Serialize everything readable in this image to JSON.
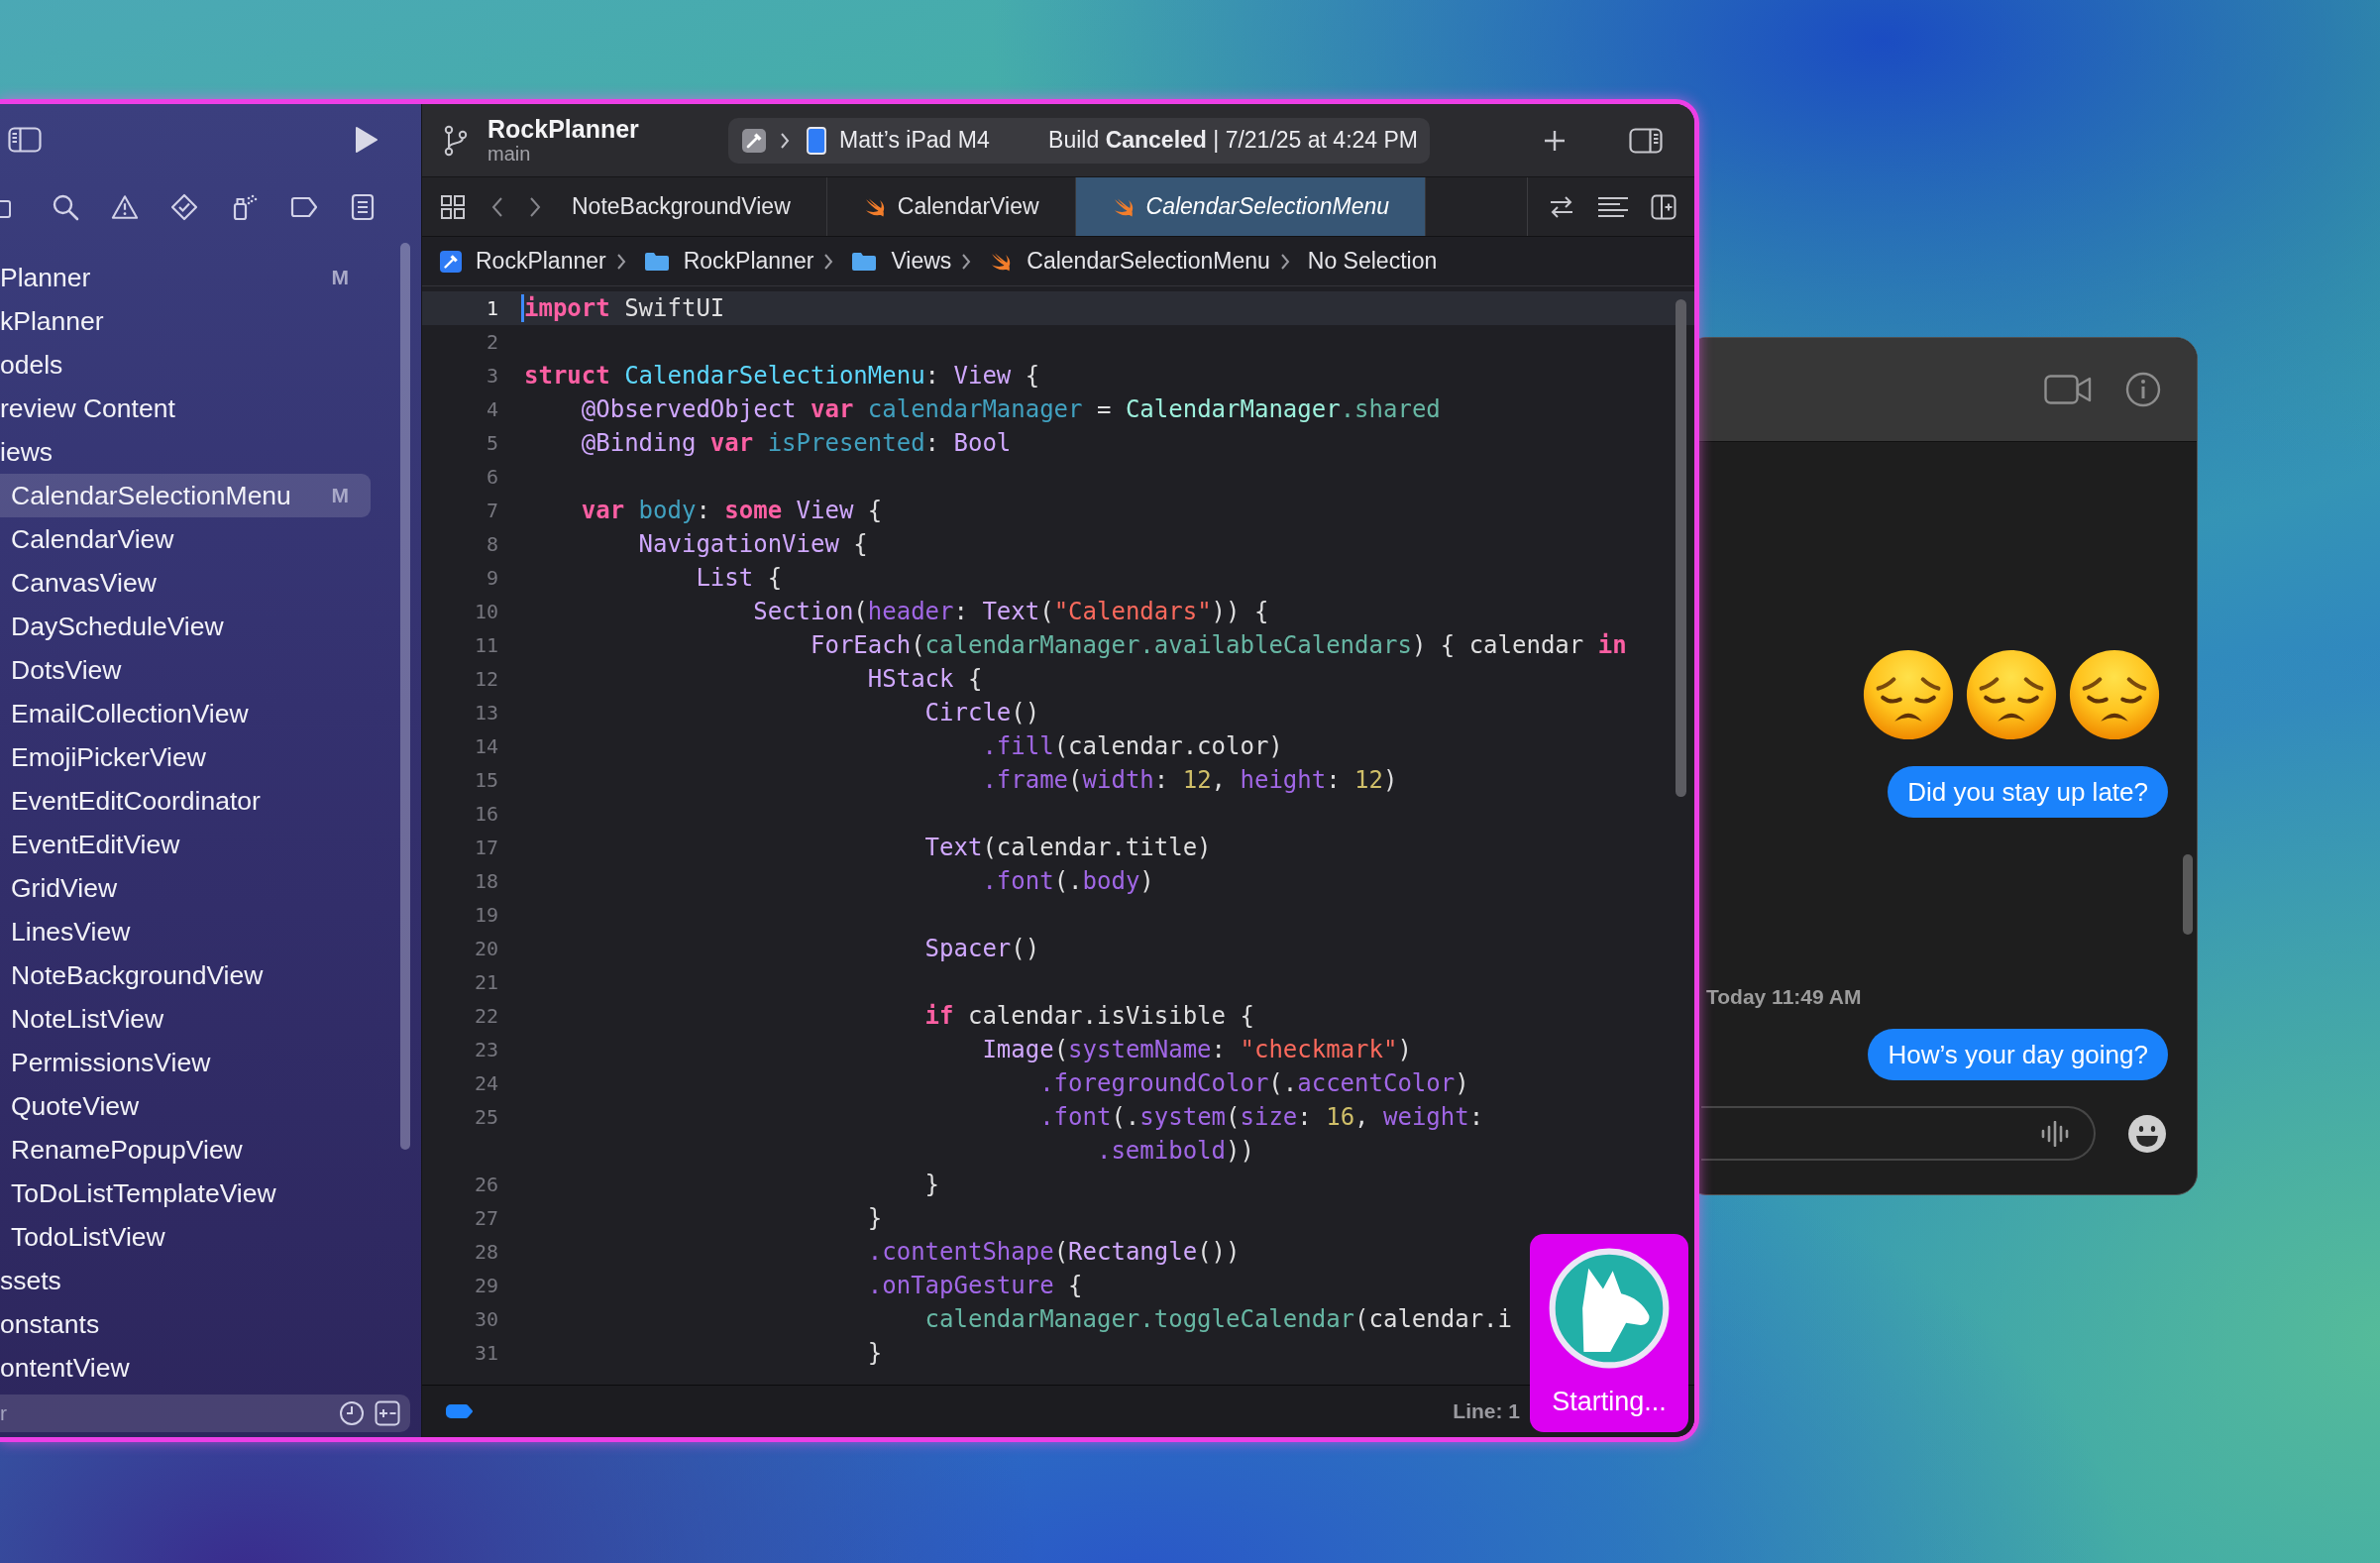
{
  "xcode": {
    "sidebar": {
      "files": [
        {
          "label": "Planner",
          "badge": "M",
          "selected": false
        },
        {
          "label": "kPlanner",
          "selected": false
        },
        {
          "label": "odels",
          "selected": false
        },
        {
          "label": "review Content",
          "selected": false
        },
        {
          "label": "iews",
          "selected": false,
          "children": [
            {
              "label": "CalendarSelectionMenu",
              "badge": "M",
              "selected": true
            },
            {
              "label": "CalendarView",
              "selected": false
            },
            {
              "label": "CanvasView",
              "selected": false
            },
            {
              "label": "DayScheduleView",
              "selected": false
            },
            {
              "label": "DotsView",
              "selected": false
            },
            {
              "label": "EmailCollectionView",
              "selected": false
            },
            {
              "label": "EmojiPickerView",
              "selected": false
            },
            {
              "label": "EventEditCoordinator",
              "selected": false
            },
            {
              "label": "EventEditView",
              "selected": false
            },
            {
              "label": "GridView",
              "selected": false
            },
            {
              "label": "LinesView",
              "selected": false
            },
            {
              "label": "NoteBackgroundView",
              "selected": false
            },
            {
              "label": "NoteListView",
              "selected": false
            },
            {
              "label": "PermissionsView",
              "selected": false
            },
            {
              "label": "QuoteView",
              "selected": false
            },
            {
              "label": "RenamePopupView",
              "selected": false
            },
            {
              "label": "ToDoListTemplateView",
              "selected": false
            },
            {
              "label": "TodoListView",
              "selected": false
            }
          ]
        },
        {
          "label": "ssets",
          "selected": false
        },
        {
          "label": "onstants",
          "selected": false
        },
        {
          "label": "ontentView",
          "selected": false
        }
      ],
      "filter": {
        "placeholder": "r"
      }
    },
    "toolbar": {
      "project": "RockPlanner",
      "branch": "main",
      "device": "Matt’s iPad M4",
      "status": "Build **Canceled** | 7/21/25 at 4:24 PM"
    },
    "tabs": [
      {
        "label": "NoteBackgroundView",
        "kind": "plain",
        "selected": false
      },
      {
        "label": "CalendarView",
        "kind": "swift",
        "selected": false
      },
      {
        "label": "CalendarSelectionMenu",
        "kind": "swift",
        "selected": true
      }
    ],
    "breadcrumb": [
      {
        "label": "RockPlanner",
        "kind": "project"
      },
      {
        "label": "RockPlanner",
        "kind": "folder"
      },
      {
        "label": "Views",
        "kind": "folder"
      },
      {
        "label": "CalendarSelectionMenu",
        "kind": "swift"
      },
      {
        "label": "No Selection",
        "kind": "text"
      }
    ],
    "editor": {
      "lines": [
        {
          "number": "1",
          "current": true,
          "tokens": [
            {
              "text": "import",
              "kind": "keyword"
            },
            {
              "text": " SwiftUI"
            }
          ]
        },
        {
          "number": "2",
          "current": false
        },
        {
          "number": "3",
          "current": false,
          "tokens": [
            {
              "text": "struct ",
              "kind": "keyword"
            },
            {
              "text": "CalendarSelectionMenu",
              "kind": "declaration_type"
            },
            {
              "text": ": "
            },
            {
              "text": "View",
              "kind": "type"
            },
            {
              "text": " {"
            }
          ]
        },
        {
          "number": "4",
          "current": false,
          "tokens": [
            {
              "text": "    @ObservedObject ",
              "kind": "type"
            },
            {
              "text": "var ",
              "kind": "keyword"
            },
            {
              "text": "calendarManager",
              "kind": "declaration"
            },
            {
              "text": " = "
            },
            {
              "text": "CalendarManager",
              "kind": "project_type"
            },
            {
              "text": ".shared",
              "kind": "project_member"
            }
          ]
        },
        {
          "number": "5",
          "current": false,
          "tokens": [
            {
              "text": "    @Binding ",
              "kind": "type"
            },
            {
              "text": "var ",
              "kind": "keyword"
            },
            {
              "text": "isPresented",
              "kind": "declaration"
            },
            {
              "text": ": "
            },
            {
              "text": "Bool",
              "kind": "type"
            }
          ]
        },
        {
          "number": "6",
          "current": false
        },
        {
          "number": "7",
          "current": false,
          "tokens": [
            {
              "text": "    var ",
              "kind": "keyword"
            },
            {
              "text": "body",
              "kind": "declaration"
            },
            {
              "text": ": "
            },
            {
              "text": "some ",
              "kind": "keyword"
            },
            {
              "text": "View",
              "kind": "type"
            },
            {
              "text": " {"
            }
          ]
        },
        {
          "number": "8",
          "current": false,
          "tokens": [
            {
              "text": "        NavigationView",
              "kind": "type"
            },
            {
              "text": " {"
            }
          ]
        },
        {
          "number": "9",
          "current": false,
          "tokens": [
            {
              "text": "            List",
              "kind": "type"
            },
            {
              "text": " {"
            }
          ]
        },
        {
          "number": "10",
          "current": false,
          "tokens": [
            {
              "text": "                Section",
              "kind": "type"
            },
            {
              "text": "("
            },
            {
              "text": "header",
              "kind": "member"
            },
            {
              "text": ": "
            },
            {
              "text": "Text",
              "kind": "type"
            },
            {
              "text": "("
            },
            {
              "text": "\"Calendars\"",
              "kind": "string"
            },
            {
              "text": ")) {"
            }
          ]
        },
        {
          "number": "11",
          "current": false,
          "tokens": [
            {
              "text": "                    ForEach",
              "kind": "type"
            },
            {
              "text": "("
            },
            {
              "text": "calendarManager.availableCalendars",
              "kind": "project_member"
            },
            {
              "text": ") { calendar "
            },
            {
              "text": "in",
              "kind": "keyword"
            }
          ]
        },
        {
          "number": "12",
          "current": false,
          "tokens": [
            {
              "text": "                        HStack",
              "kind": "type"
            },
            {
              "text": " {"
            }
          ]
        },
        {
          "number": "13",
          "current": false,
          "tokens": [
            {
              "text": "                            Circle",
              "kind": "type"
            },
            {
              "text": "()"
            }
          ]
        },
        {
          "number": "14",
          "current": false,
          "tokens": [
            {
              "text": "                                .fill",
              "kind": "member"
            },
            {
              "text": "(calendar.color)"
            }
          ]
        },
        {
          "number": "15",
          "current": false,
          "tokens": [
            {
              "text": "                                .frame",
              "kind": "member"
            },
            {
              "text": "("
            },
            {
              "text": "width",
              "kind": "member"
            },
            {
              "text": ": "
            },
            {
              "text": "12",
              "kind": "number"
            },
            {
              "text": ", "
            },
            {
              "text": "height",
              "kind": "member"
            },
            {
              "text": ": "
            },
            {
              "text": "12",
              "kind": "number"
            },
            {
              "text": ")"
            }
          ]
        },
        {
          "number": "16",
          "current": false
        },
        {
          "number": "17",
          "current": false,
          "tokens": [
            {
              "text": "                            Text",
              "kind": "type"
            },
            {
              "text": "(calendar.title)"
            }
          ]
        },
        {
          "number": "18",
          "current": false,
          "tokens": [
            {
              "text": "                                .font",
              "kind": "member"
            },
            {
              "text": "(."
            },
            {
              "text": "body",
              "kind": "member"
            },
            {
              "text": ")"
            }
          ]
        },
        {
          "number": "19",
          "current": false
        },
        {
          "number": "20",
          "current": false,
          "tokens": [
            {
              "text": "                            Spacer",
              "kind": "type"
            },
            {
              "text": "()"
            }
          ]
        },
        {
          "number": "21",
          "current": false
        },
        {
          "number": "22",
          "current": false,
          "tokens": [
            {
              "text": "                            if",
              "kind": "keyword"
            },
            {
              "text": " calendar.isVisible {"
            }
          ]
        },
        {
          "number": "23",
          "current": false,
          "tokens": [
            {
              "text": "                                Image",
              "kind": "type"
            },
            {
              "text": "("
            },
            {
              "text": "systemName",
              "kind": "member"
            },
            {
              "text": ": "
            },
            {
              "text": "\"checkmark\"",
              "kind": "string"
            },
            {
              "text": ")"
            }
          ]
        },
        {
          "number": "24",
          "current": false,
          "tokens": [
            {
              "text": "                                    .foregroundColor",
              "kind": "member"
            },
            {
              "text": "(."
            },
            {
              "text": "accentColor",
              "kind": "member"
            },
            {
              "text": ")"
            }
          ]
        },
        {
          "number": "25",
          "current": false,
          "tokens": [
            {
              "text": "                                    .font",
              "kind": "member"
            },
            {
              "text": "(."
            },
            {
              "text": "system",
              "kind": "member"
            },
            {
              "text": "("
            },
            {
              "text": "size",
              "kind": "member"
            },
            {
              "text": ": "
            },
            {
              "text": "16",
              "kind": "number"
            },
            {
              "text": ", "
            },
            {
              "text": "weight",
              "kind": "member"
            },
            {
              "text": ":"
            }
          ],
          "continuation": [
            {
              "text": "                                        .semibold",
              "kind": "member"
            },
            {
              "text": "))"
            }
          ]
        },
        {
          "number": "26",
          "current": false,
          "tokens": [
            {
              "text": "                            }"
            }
          ]
        },
        {
          "number": "27",
          "current": false,
          "tokens": [
            {
              "text": "                        }"
            }
          ]
        },
        {
          "number": "28",
          "current": false,
          "tokens": [
            {
              "text": "                        .contentShape",
              "kind": "member"
            },
            {
              "text": "("
            },
            {
              "text": "Rectangle",
              "kind": "type"
            },
            {
              "text": "())"
            }
          ]
        },
        {
          "number": "29",
          "current": false,
          "tokens": [
            {
              "text": "                        .onTapGesture",
              "kind": "member"
            },
            {
              "text": " {"
            }
          ]
        },
        {
          "number": "30",
          "current": false,
          "tokens": [
            {
              "text": "                            calendarManager.toggleCalendar",
              "kind": "project_member"
            },
            {
              "text": "(calendar.i"
            }
          ]
        },
        {
          "number": "31",
          "current": false,
          "tokens": [
            {
              "text": "                        }"
            }
          ]
        }
      ]
    },
    "status_bar": {
      "position": "Line: 1"
    },
    "agent_overlay": {
      "status": "Starting..."
    }
  },
  "messages_window": {
    "items": [
      {
        "kind": "emoji_row",
        "emojis": [
          {
            "kind": "disappointed"
          },
          {
            "kind": "disappointed"
          },
          {
            "kind": "disappointed"
          }
        ]
      },
      {
        "kind": "bubble",
        "text": "Did you stay up late?"
      },
      {
        "kind": "timestamp",
        "text": "Today 11:49 AM"
      },
      {
        "kind": "bubble",
        "text": "How’s your day going?"
      }
    ]
  }
}
